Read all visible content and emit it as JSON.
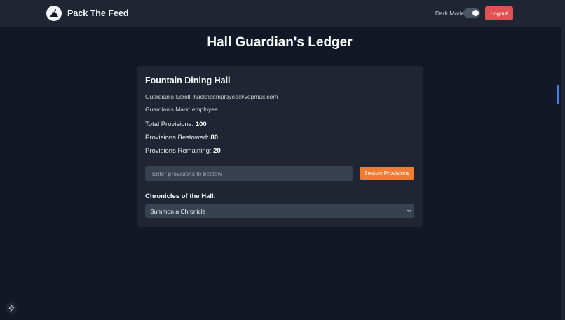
{
  "navbar": {
    "brand": "Pack The Feed",
    "logo_icon": "wolf-howl-icon",
    "dark_mode_label": "Dark Mode",
    "dark_mode_on": true,
    "logout_label": "Logout"
  },
  "page": {
    "title": "Hall Guardian's Ledger"
  },
  "card": {
    "hall_name": "Fountain Dining Hall",
    "scroll_label": "Guardian's Scroll: ",
    "scroll_value": "hackncemployee@yopmail.com",
    "mark_label": "Guardian's Mark: ",
    "mark_value": "employee",
    "total_label": "Total Provisions: ",
    "total_value": "100",
    "bestowed_label": "Provisions Bestowed: ",
    "bestowed_value": "80",
    "remaining_label": "Provisions Remaining: ",
    "remaining_value": "20",
    "input_placeholder": "Enter provisions to bestow",
    "input_value": "",
    "bestow_label": "Bestow Provisions",
    "chronicles_label": "Chronicles of the Hall:",
    "chronicle_selected": "Summon a Chronicle"
  },
  "colors": {
    "background": "#121826",
    "surface": "#1f2533",
    "accent_orange": "#f07c33",
    "logout_red": "#e05252",
    "scroll_thumb": "#3b82f6"
  }
}
